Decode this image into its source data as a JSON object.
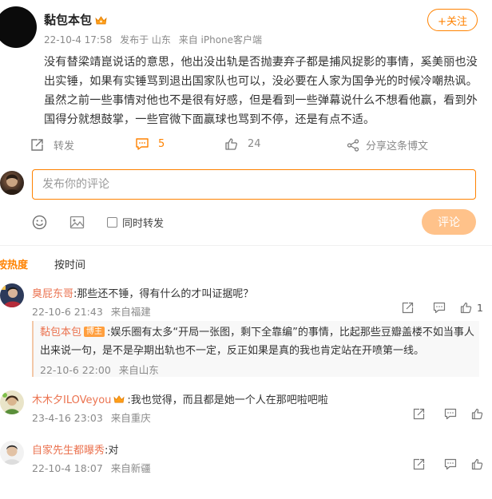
{
  "post": {
    "author": "黏包本包",
    "date": "22-10-4 17:58",
    "location": "发布于 山东",
    "source": "来自 iPhone客户端",
    "follow_label": "+关注",
    "content": "没有替梁靖崑说话的意思，他出没出轨是否抛妻弃子都是捕风捉影的事情，奚美丽也没出实锤，如果有实锤骂到退出国家队也可以，没必要在人家为国争光的时候冷嘲热讽。 虽然之前一些事情对他也不是很有好感，但是看到一些弹幕说什么不想看他赢，看到外国得分就想鼓掌，一些官微下面赢球也骂到不停，还是有点不适。"
  },
  "actions": {
    "repost_label": "转发",
    "comment_count": "5",
    "like_count": "24",
    "share_label": "分享这条博文"
  },
  "composer": {
    "placeholder": "发布你的评论",
    "repost_checkbox_label": "同时转发",
    "submit_label": "评论"
  },
  "sort": {
    "hot_label": "按热度",
    "time_label": "按时间"
  },
  "comments": [
    {
      "name": "臭屁东哥",
      "text": ":那些还不锤，得有什么的才叫证据呢？",
      "date": "22-10-6 21:43",
      "from": "来自福建",
      "likes": "1"
    },
    {
      "name": "木木夕ILOVeyou",
      "text": ":我也觉得，而且都是她一个人在那吧啦吧啦",
      "date": "23-4-16 23:03",
      "from": "来自重庆"
    },
    {
      "name": "自家先生都曝秀",
      "text": ":对",
      "date": "22-10-4 18:07",
      "from": "来自新疆"
    }
  ],
  "reply": {
    "name": "黏包本包",
    "badge": "博主",
    "text": ":娱乐圈有太多“开局一张图，剩下全靠编”的事情，比起那些豆瓣盖楼不如当事人出来说一句，是不是孕期出轨也不一定，反正如果是真的我也肯定站在开喷第一线。",
    "date": "22-10-6 22:00",
    "from": "来自山东"
  },
  "colors": {
    "accent": "#ff8200",
    "name_link": "#eb7350",
    "submit_disabled": "#ffc28a"
  },
  "icons": [
    "crown-icon",
    "repost-icon",
    "comment-icon",
    "like-icon",
    "share-icon",
    "emoji-icon",
    "image-icon",
    "reply-icon",
    "like-icon"
  ]
}
